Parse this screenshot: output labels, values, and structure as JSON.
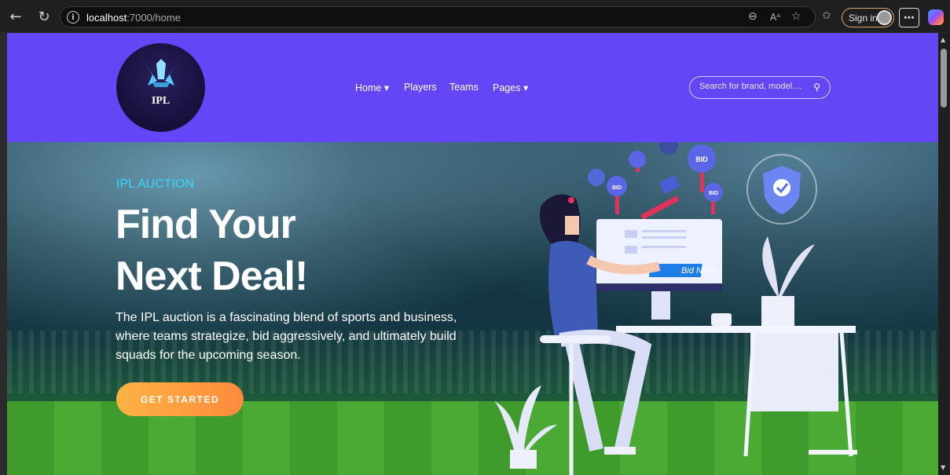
{
  "browser": {
    "url_host": "localhost",
    "url_path": ":7000/home",
    "signin_label": "Sign in"
  },
  "header": {
    "logo_text": "IPL",
    "nav": [
      {
        "label": "Home"
      },
      {
        "label": "Players"
      },
      {
        "label": "Teams"
      },
      {
        "label": "Pages"
      }
    ],
    "search_placeholder": "Search for brand, model...."
  },
  "hero": {
    "eyebrow": "IPL AUCTION",
    "title_line1": "Find Your",
    "title_line2": "Next Deal!",
    "description": "The IPL auction is a fascinating blend of sports and business, where teams strategize, bid aggressively, and ultimately build squads for the upcoming season.",
    "cta_label": "GET STARTED",
    "illustration": {
      "bid_badge": "BID",
      "bid_button": "Bid Now!"
    }
  },
  "colors": {
    "header_bg": "#6546f6",
    "eyebrow": "#33d6ff",
    "cta_start": "#fdb344",
    "cta_end": "#ff8a3d"
  }
}
